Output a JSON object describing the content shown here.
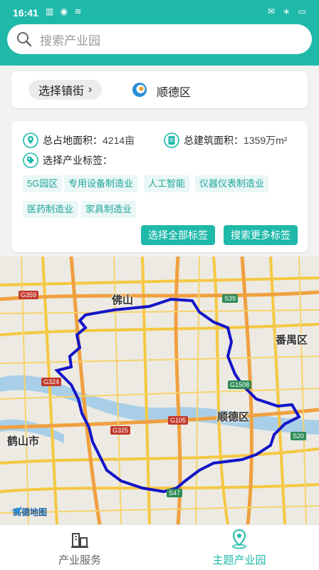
{
  "status_bar": {
    "time": "16:41",
    "left_icons": "▥ ◉ ≋",
    "right_icons": "✉ ∗ ▭"
  },
  "search": {
    "placeholder": "搜索产业园"
  },
  "location": {
    "town_button": "选择镇街",
    "district": "顺德区"
  },
  "stats": {
    "land_area_label": "总占地面积：",
    "land_area_value": "4214亩",
    "building_area_label": "总建筑面积：",
    "building_area_value": "1359万m²"
  },
  "tags_section": {
    "title": "选择产业标签：",
    "tags": [
      "5G园区",
      "专用设备制造业",
      "人工智能",
      "仪器仪表制造业",
      "医药制造业",
      "家具制造业"
    ],
    "select_all_label": "选择全部标签",
    "search_more_label": "搜索更多标签"
  },
  "map": {
    "labels": [
      "佛山",
      "番禺区",
      "顺德区",
      "鹤山市"
    ],
    "road_labels": [
      "G359",
      "S39",
      "G324",
      "G1508",
      "G325",
      "G105",
      "S20",
      "S47"
    ],
    "attribution": "高德地图",
    "boundary_color": "#1414c8"
  },
  "tabbar": {
    "items": [
      "产业服务",
      "主题产业园"
    ],
    "active_color": "#1fb9a9"
  },
  "colors": {
    "primary": "#1fb9a9",
    "tag_bg": "#eaf7f6"
  }
}
